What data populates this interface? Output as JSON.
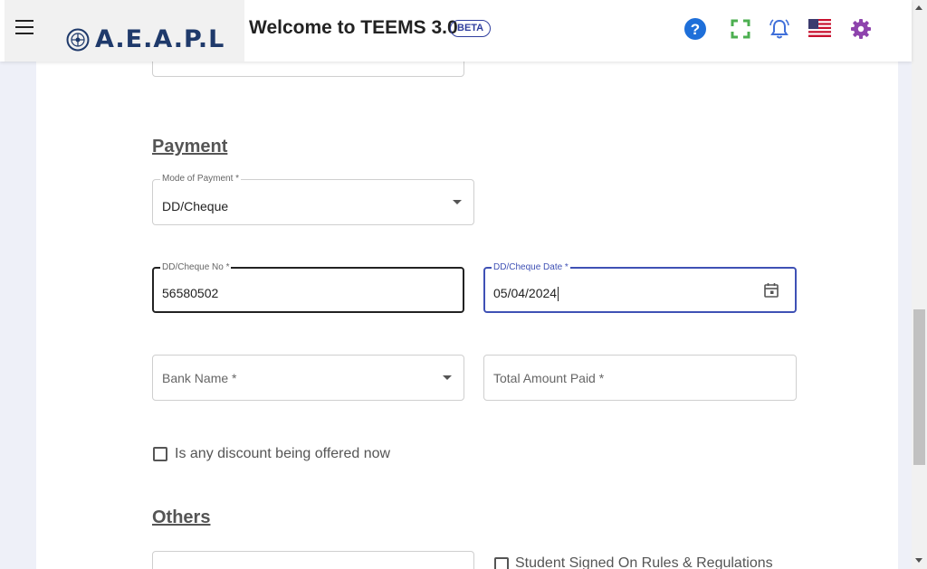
{
  "header": {
    "logo_text": "A.E.A.P.L",
    "welcome": "Welcome to TEEMS 3.0",
    "badge": "BETA",
    "icons": [
      "menu-icon",
      "help-icon",
      "fullscreen-icon",
      "notification-bell-icon",
      "us-flag-icon",
      "settings-gear-icon"
    ]
  },
  "payment": {
    "title": "Payment",
    "mode_label": "Mode of Payment *",
    "mode_value": "DD/Cheque",
    "cheque_no_label": "DD/Cheque No *",
    "cheque_no_value": "56580502",
    "cheque_date_label": "DD/Cheque Date *",
    "cheque_date_value": "05/04/2024",
    "bank_name_placeholder": "Bank Name *",
    "total_amount_placeholder": "Total Amount Paid *",
    "discount_label": "Is any discount being offered now"
  },
  "others": {
    "title": "Others",
    "signed_label": "Student Signed On Rules & Regulations"
  },
  "colors": {
    "accent": "#3f51b5",
    "help": "#1e6fd9",
    "fullscreen": "#4caf50",
    "bell": "#3f6fd9",
    "gear": "#8e44ad"
  }
}
